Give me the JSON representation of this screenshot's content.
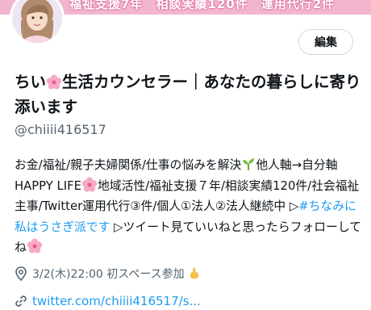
{
  "banner": {
    "text": "福祉支援7年　相談実績120件　運用代行2件"
  },
  "header": {
    "edit_label": "編集"
  },
  "profile": {
    "name_part1": "ちい",
    "name_part2": "生活カウンセラー｜あなたの暮らしに寄り添います",
    "handle": "@chiiii416517",
    "bio": {
      "seg1": "お金/福祉/親子夫婦関係/仕事の悩みを解決",
      "seg2": "他人軸→自分軸HAPPY LIFE",
      "seg3": "地域活性/福祉支援７年/相談実績120件/社会福祉主事/Twitter運用代行③件/個人①法人②法人継続中 ▷",
      "hashtag": "#ちなみに私はうさぎ派です",
      "seg4": " ▷ツイート見ていいねと思ったらフォローしてね"
    },
    "location": "3/2(木)22:00 初スペース参加",
    "url": "twitter.com/chiiii416517/s..."
  },
  "colors": {
    "accent": "#1d9bf0",
    "muted": "#536471",
    "banner": "#f3b6cf"
  },
  "icons": {
    "location": "location-pin-icon",
    "link": "link-icon",
    "flower": "cherry-blossom-icon",
    "seedling": "seedling-icon",
    "hand": "pointing-down-icon"
  }
}
